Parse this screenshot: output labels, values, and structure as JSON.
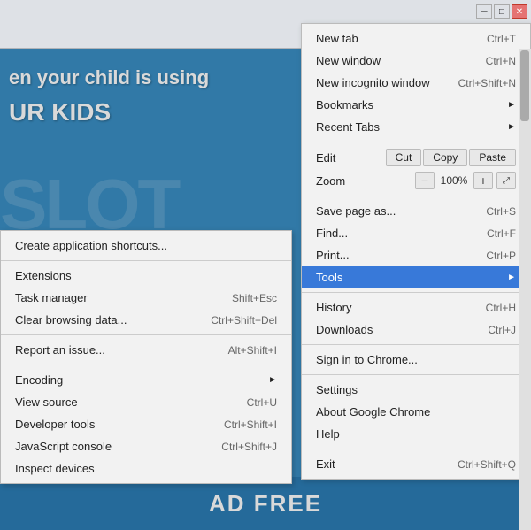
{
  "browser": {
    "title_bar": {
      "minimize": "─",
      "maximize": "□",
      "close": "✕"
    },
    "toolbar": {
      "star": "☆",
      "menu": "≡"
    }
  },
  "page": {
    "heading1": "en your child is using",
    "heading2": "UR KIDS",
    "watermark": "SLOT",
    "bottom_banner": "AD FREE",
    "url_prefix": "/.."
  },
  "main_menu": {
    "items": [
      {
        "id": "new-tab",
        "label": "New tab",
        "shortcut": "Ctrl+T",
        "has_arrow": false
      },
      {
        "id": "new-window",
        "label": "New window",
        "shortcut": "Ctrl+N",
        "has_arrow": false
      },
      {
        "id": "new-incognito-window",
        "label": "New incognito window",
        "shortcut": "Ctrl+Shift+N",
        "has_arrow": false
      },
      {
        "id": "bookmarks",
        "label": "Bookmarks",
        "shortcut": "",
        "has_arrow": true
      },
      {
        "id": "recent-tabs",
        "label": "Recent Tabs",
        "shortcut": "",
        "has_arrow": true
      },
      {
        "id": "separator1",
        "type": "separator"
      },
      {
        "id": "edit-row",
        "type": "edit-row",
        "label": "Edit",
        "cut": "Cut",
        "copy": "Copy",
        "paste": "Paste"
      },
      {
        "id": "zoom-row",
        "type": "zoom-row",
        "label": "Zoom",
        "minus": "−",
        "value": "100%",
        "plus": "+",
        "fullscreen": "⤢"
      },
      {
        "id": "separator2",
        "type": "separator"
      },
      {
        "id": "save-page",
        "label": "Save page as...",
        "shortcut": "Ctrl+S",
        "has_arrow": false
      },
      {
        "id": "find",
        "label": "Find...",
        "shortcut": "Ctrl+F",
        "has_arrow": false
      },
      {
        "id": "print",
        "label": "Print...",
        "shortcut": "Ctrl+P",
        "has_arrow": false
      },
      {
        "id": "tools",
        "label": "Tools",
        "shortcut": "",
        "has_arrow": true,
        "active": true
      },
      {
        "id": "separator3",
        "type": "separator"
      },
      {
        "id": "history",
        "label": "History",
        "shortcut": "Ctrl+H",
        "has_arrow": false
      },
      {
        "id": "downloads",
        "label": "Downloads",
        "shortcut": "Ctrl+J",
        "has_arrow": false
      },
      {
        "id": "separator4",
        "type": "separator"
      },
      {
        "id": "signin",
        "label": "Sign in to Chrome...",
        "shortcut": "",
        "has_arrow": false
      },
      {
        "id": "separator5",
        "type": "separator"
      },
      {
        "id": "settings",
        "label": "Settings",
        "shortcut": "",
        "has_arrow": false
      },
      {
        "id": "about-chrome",
        "label": "About Google Chrome",
        "shortcut": "",
        "has_arrow": false
      },
      {
        "id": "help",
        "label": "Help",
        "shortcut": "",
        "has_arrow": false
      },
      {
        "id": "separator6",
        "type": "separator"
      },
      {
        "id": "exit",
        "label": "Exit",
        "shortcut": "Ctrl+Shift+Q",
        "has_arrow": false
      }
    ]
  },
  "submenu_tools": {
    "items": [
      {
        "id": "create-shortcuts",
        "label": "Create application shortcuts...",
        "shortcut": ""
      },
      {
        "id": "separator1",
        "type": "separator"
      },
      {
        "id": "extensions",
        "label": "Extensions",
        "shortcut": ""
      },
      {
        "id": "task-manager",
        "label": "Task manager",
        "shortcut": "Shift+Esc"
      },
      {
        "id": "clear-browsing",
        "label": "Clear browsing data...",
        "shortcut": "Ctrl+Shift+Del"
      },
      {
        "id": "separator2",
        "type": "separator"
      },
      {
        "id": "report-issue",
        "label": "Report an issue...",
        "shortcut": "Alt+Shift+I"
      },
      {
        "id": "separator3",
        "type": "separator"
      },
      {
        "id": "encoding",
        "label": "Encoding",
        "shortcut": "",
        "has_arrow": true
      },
      {
        "id": "view-source",
        "label": "View source",
        "shortcut": "Ctrl+U"
      },
      {
        "id": "developer-tools",
        "label": "Developer tools",
        "shortcut": "Ctrl+Shift+I"
      },
      {
        "id": "javascript-console",
        "label": "JavaScript console",
        "shortcut": "Ctrl+Shift+J"
      },
      {
        "id": "inspect-devices",
        "label": "Inspect devices",
        "shortcut": ""
      }
    ]
  }
}
